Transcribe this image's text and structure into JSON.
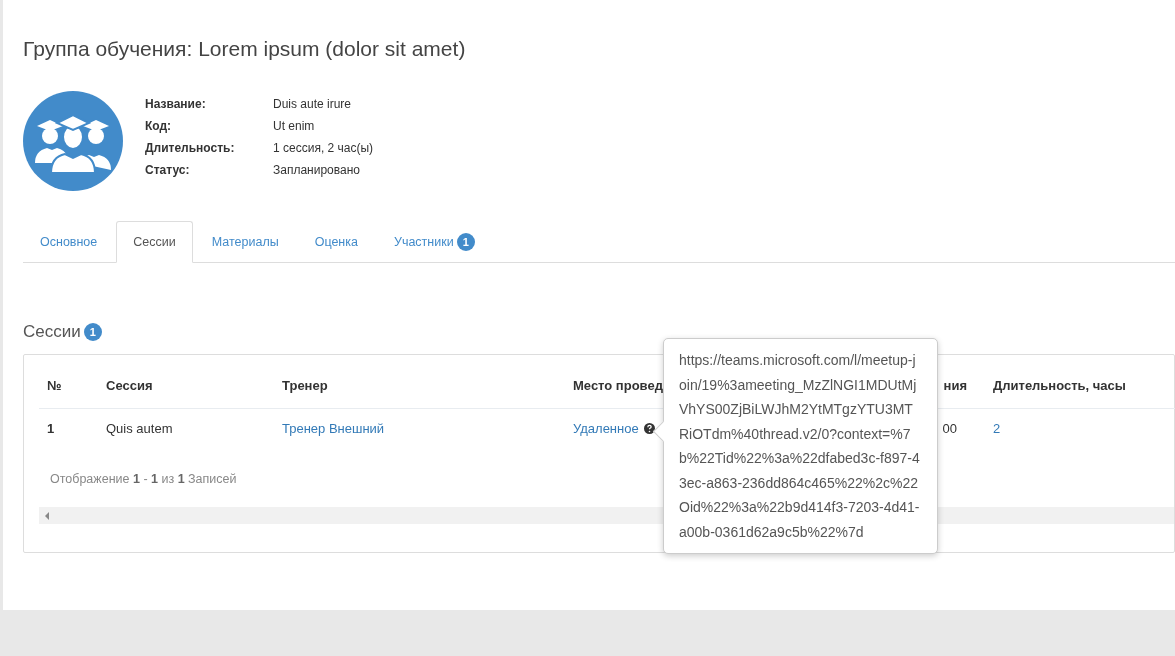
{
  "page_title": "Группа обучения: Lorem ipsum (dolor sit amet)",
  "details": [
    {
      "label": "Название:",
      "value": "Duis aute irure"
    },
    {
      "label": "Код:",
      "value": "Ut enim"
    },
    {
      "label": "Длительность:",
      "value": "1 сессия, 2 час(ы)"
    },
    {
      "label": "Статус:",
      "value": "Запланировано"
    }
  ],
  "tabs": [
    {
      "label": "Основное",
      "selected": false
    },
    {
      "label": "Сессии",
      "selected": true
    },
    {
      "label": "Материалы",
      "selected": false
    },
    {
      "label": "Оценка",
      "selected": false
    },
    {
      "label": "Участники",
      "selected": false,
      "badge": "1"
    }
  ],
  "section": {
    "title": "Сессии",
    "badge": "1"
  },
  "table": {
    "columns": [
      "№",
      "Сессия",
      "Тренер",
      "Место провед",
      "ния",
      "Длительность, часы"
    ],
    "rows": [
      {
        "cells": [
          "1",
          "Quis autem",
          "Тренер Внешний",
          "Удаленное",
          "00",
          "2"
        ]
      }
    ]
  },
  "footer": {
    "text": "Отображение **1** - **1** из **1** Записей"
  },
  "tooltip": {
    "text": "https://teams.microsoft.com/l/meetup-join/19%3ameeting_MzZlNGI1MDUtMjVhYS00ZjBiLWJhM2YtMTgzYTU3MTRiOTdm%40thread.v2/0?context=%7b%22Tid%22%3a%22dfabed3c-f897-43ec-a863-236dd864c465%22%2c%22Oid%22%3a%22b9d414f3-7203-4d41-a00b-0361d62a9c5b%22%7d"
  }
}
